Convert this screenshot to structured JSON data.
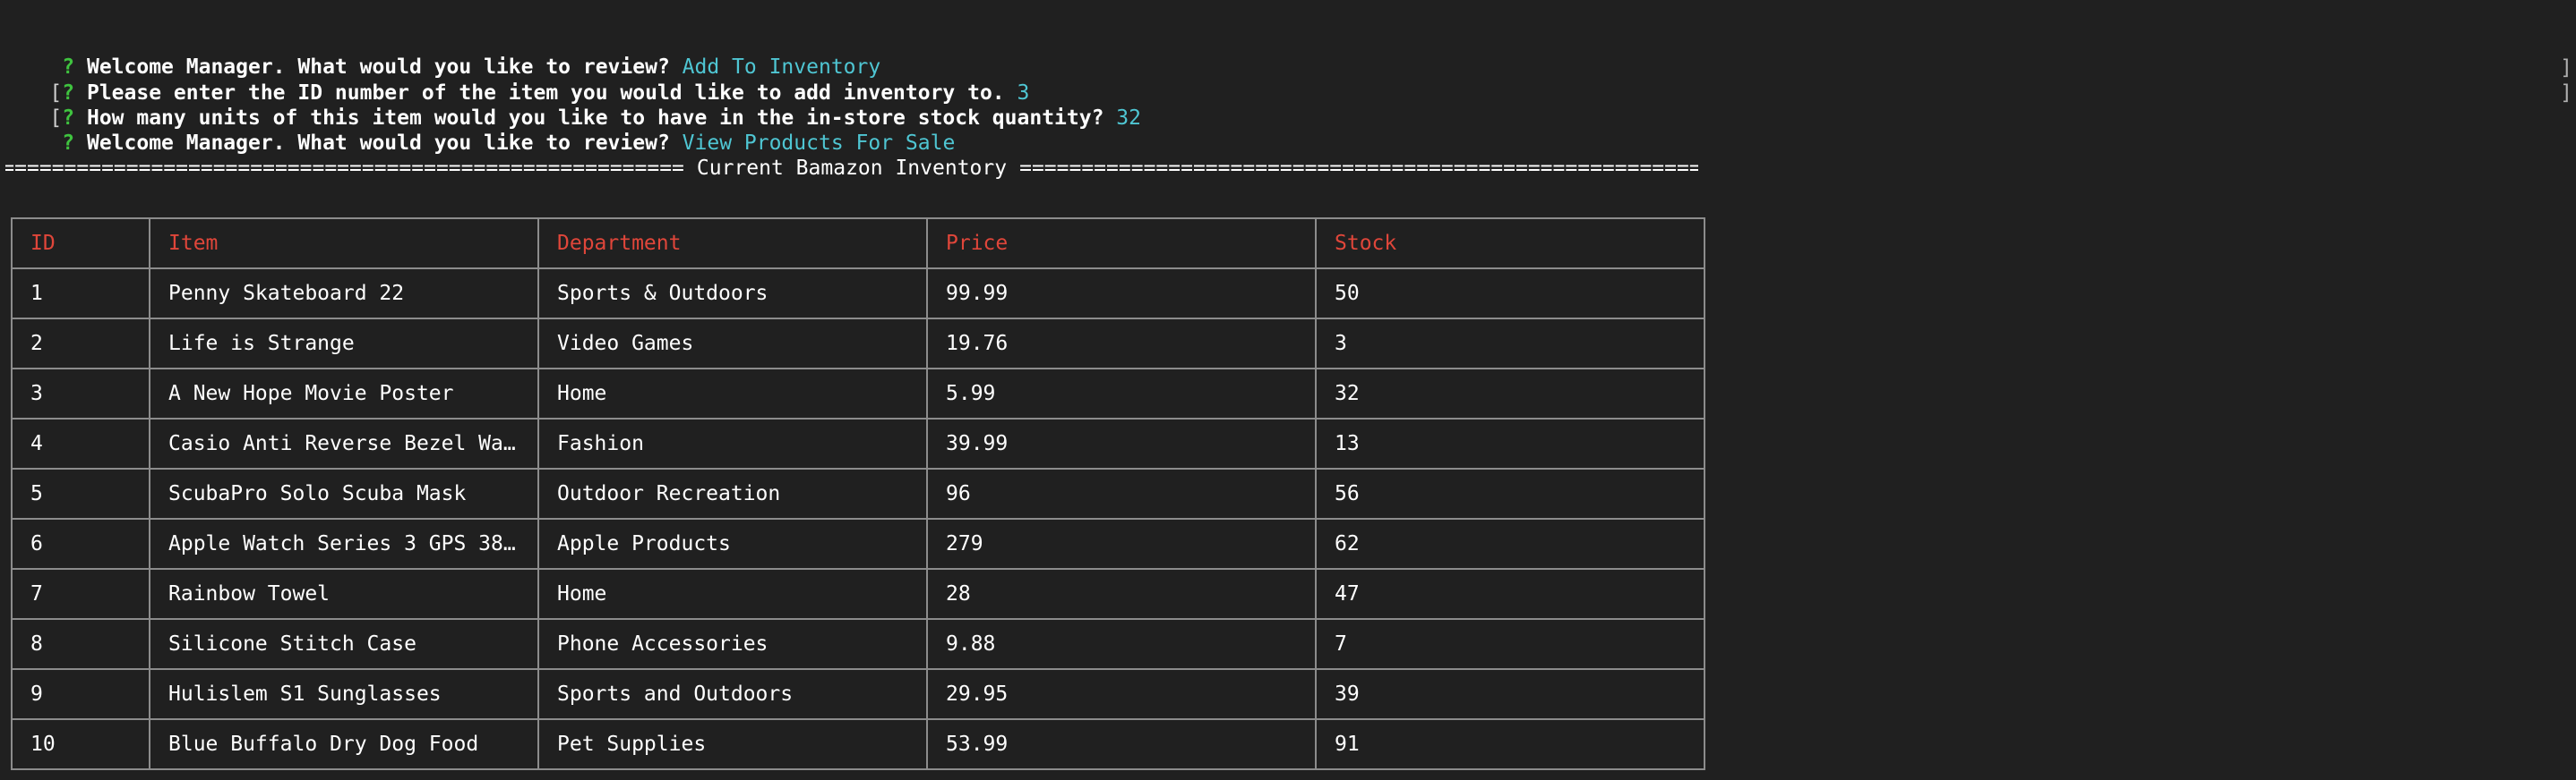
{
  "session": {
    "lines": [
      {
        "lead": "?",
        "bracketed": false,
        "question": "Welcome Manager. What would you like to review?",
        "answer": "Add To Inventory"
      },
      {
        "lead": "?",
        "bracketed": true,
        "question": "Please enter the ID number of the item you would like to add inventory to.",
        "answer": "3"
      },
      {
        "lead": "?",
        "bracketed": true,
        "question": "How many units of this item would you like to have in the in-store stock quantity?",
        "answer": "32"
      },
      {
        "lead": "?",
        "bracketed": false,
        "question": "Welcome Manager. What would you like to review?",
        "answer": "View Products For Sale"
      }
    ],
    "right_bracket": "]"
  },
  "banner": {
    "rule": "================================================================================================================",
    "title": "Current Bamazon Inventory"
  },
  "table": {
    "headers": [
      "ID",
      "Item",
      "Department",
      "Price",
      "Stock"
    ],
    "rows": [
      [
        "1",
        "Penny Skateboard 22",
        "Sports & Outdoors",
        "99.99",
        "50"
      ],
      [
        "2",
        "Life is Strange",
        "Video Games",
        "19.76",
        "3"
      ],
      [
        "3",
        "A New Hope Movie Poster",
        "Home",
        "5.99",
        "32"
      ],
      [
        "4",
        "Casio Anti Reverse Bezel Wa…",
        "Fashion",
        "39.99",
        "13"
      ],
      [
        "5",
        "ScubaPro Solo Scuba Mask",
        "Outdoor Recreation",
        "96",
        "56"
      ],
      [
        "6",
        "Apple Watch Series 3 GPS 38…",
        "Apple Products",
        "279",
        "62"
      ],
      [
        "7",
        "Rainbow Towel",
        "Home",
        "28",
        "47"
      ],
      [
        "8",
        "Silicone Stitch Case",
        "Phone Accessories",
        "9.88",
        "7"
      ],
      [
        "9",
        "Hulislem S1 Sunglasses",
        "Sports and Outdoors",
        "29.95",
        "39"
      ],
      [
        "10",
        "Blue Buffalo Dry Dog Food",
        "Pet Supplies",
        "53.99",
        "91"
      ]
    ]
  },
  "colors": {
    "background": "#202020",
    "prompt": "#3fc33f",
    "answer": "#4fc6d3",
    "header": "#e0463a",
    "border": "#8c8c8c"
  }
}
